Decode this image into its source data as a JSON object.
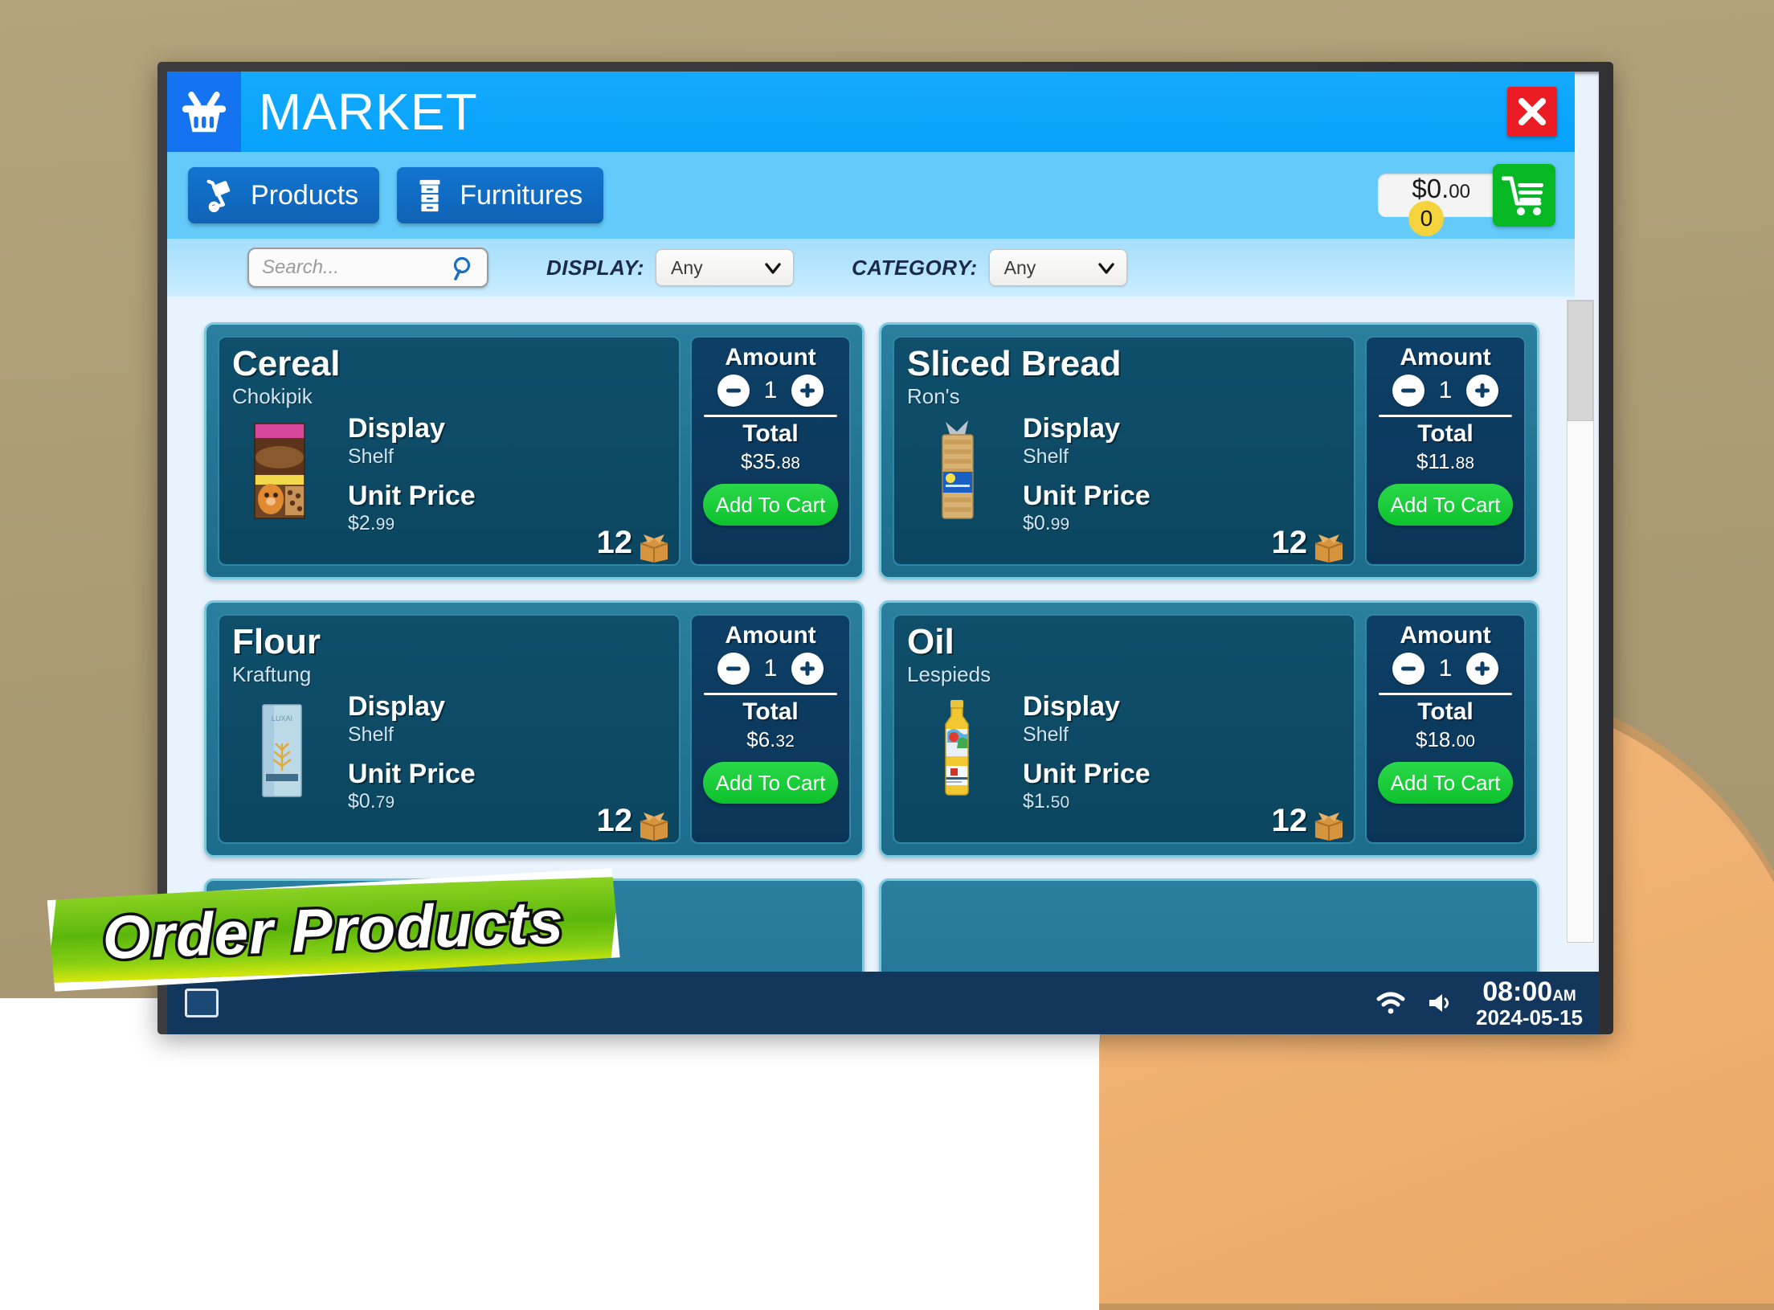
{
  "window": {
    "title": "MARKET",
    "logo_icon": "shopping-basket-icon",
    "close_icon": "close-x-icon"
  },
  "tabs": [
    {
      "label": "Products",
      "icon": "hand-truck-icon",
      "active": true
    },
    {
      "label": "Furnitures",
      "icon": "file-cabinet-icon",
      "active": false
    }
  ],
  "cart": {
    "total": "$0.",
    "total_cents": "00",
    "badge_count": "0",
    "icon": "shopping-cart-icon"
  },
  "filters": {
    "search_placeholder": "Search...",
    "search_value": "",
    "search_icon": "magnifier-icon",
    "display_label": "DISPLAY:",
    "display_value": "Any",
    "category_label": "CATEGORY:",
    "category_value": "Any",
    "chevron_icon": "chevron-down-icon"
  },
  "labels": {
    "display": "Display",
    "unit_price": "Unit Price",
    "amount": "Amount",
    "total": "Total",
    "add_to_cart": "Add To Cart",
    "minus_icon": "minus-circle-icon",
    "plus_icon": "plus-circle-icon",
    "box_icon": "cardboard-box-icon"
  },
  "products": [
    {
      "name": "Cereal",
      "brand": "Chokipik",
      "display": "Shelf",
      "unit_price": "$2.",
      "unit_price_cents": "99",
      "stock": "12",
      "amount": "1",
      "total": "$35.",
      "total_cents": "88",
      "thumb": "cereal-box-thumb"
    },
    {
      "name": "Sliced Bread",
      "brand": "Ron's",
      "display": "Shelf",
      "unit_price": "$0.",
      "unit_price_cents": "99",
      "stock": "12",
      "amount": "1",
      "total": "$11.",
      "total_cents": "88",
      "thumb": "bread-loaf-thumb"
    },
    {
      "name": "Flour",
      "brand": "Kraftung",
      "display": "Shelf",
      "unit_price": "$0.",
      "unit_price_cents": "79",
      "stock": "12",
      "amount": "1",
      "total": "$6.",
      "total_cents": "32",
      "thumb": "flour-box-thumb"
    },
    {
      "name": "Oil",
      "brand": "Lespieds",
      "display": "Shelf",
      "unit_price": "$1.",
      "unit_price_cents": "50",
      "stock": "12",
      "amount": "1",
      "total": "$18.",
      "total_cents": "00",
      "thumb": "oil-bottle-thumb"
    }
  ],
  "banner": {
    "text": "Order Products"
  },
  "taskbar": {
    "start_icon": "window-icon",
    "wifi_icon": "wifi-icon",
    "volume_icon": "speaker-icon",
    "time": "08:00",
    "ampm": "AM",
    "date": "2024-05-15"
  },
  "colors": {
    "titlebar": "#07a2fb",
    "tabbar": "#63cafa",
    "accent_green": "#06b924",
    "close_red": "#ec1c24",
    "card_body": "#0f4f6b",
    "card_frame": "#1d6c8c",
    "badge_yellow": "#f5d33c",
    "desk": "#f0b273",
    "wall": "#ab9a73"
  }
}
